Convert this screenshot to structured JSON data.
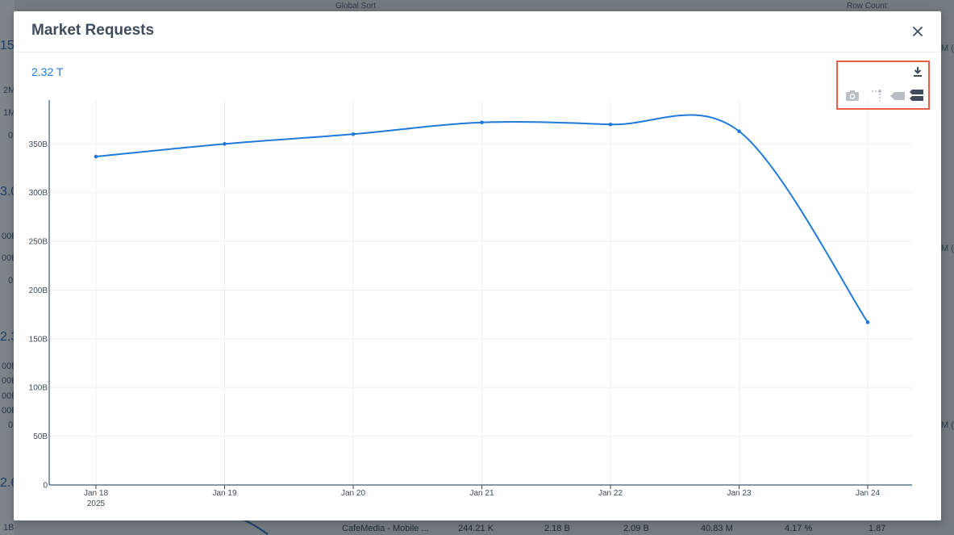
{
  "modal": {
    "title": "Market Requests",
    "total": "2.32 T"
  },
  "toolbar": {
    "download_icon": "download-icon",
    "camera_icon": "camera-icon",
    "compare_icon": "compare-data-icon",
    "hover_closest_icon": "hover-closest-icon",
    "hover_compare_icon": "hover-compare-icon"
  },
  "colors": {
    "line": "#1f7ad8",
    "title": "#3e4c5c",
    "highlight": "#e8604c"
  },
  "chart_data": {
    "type": "line",
    "categories": [
      "Jan 18",
      "Jan 19",
      "Jan 20",
      "Jan 21",
      "Jan 22",
      "Jan 23",
      "Jan 24"
    ],
    "year_label": "2025",
    "series": [
      {
        "values": [
          337,
          350,
          360,
          372,
          370,
          363,
          167
        ]
      }
    ],
    "value_unit": "B",
    "y_ticks": [
      "0",
      "50B",
      "100B",
      "150B",
      "200B",
      "250B",
      "300B",
      "350B"
    ],
    "ylim": [
      0,
      395
    ],
    "grid": true
  },
  "background": {
    "left_labels": [
      "2M",
      "1M",
      "0",
      "00B",
      "00B",
      "0",
      "00B",
      "00B",
      "00B",
      "00B",
      "0",
      "1B"
    ],
    "left_big": [
      "15.",
      "3.0",
      "2.3",
      "2.6"
    ],
    "right_labels": [
      "M (",
      "M (",
      "M ("
    ],
    "top_labels": [
      "Global Sort",
      "Row Count:"
    ],
    "footer": [
      "CafeMedia - Mobile ...",
      "244.21 K",
      "2.18 B",
      "2.09 B",
      "40.83 M",
      "4.17 %",
      "1.87"
    ]
  }
}
